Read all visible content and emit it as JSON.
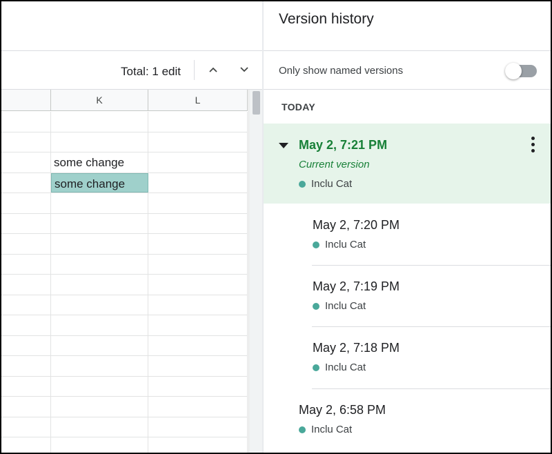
{
  "toolbar": {
    "total": "Total: 1 edit"
  },
  "grid": {
    "columns": [
      "K",
      "L"
    ],
    "cells": [
      {
        "row": 2,
        "text": "some change"
      },
      {
        "row": 3,
        "text": "some change"
      }
    ]
  },
  "panel": {
    "title": "Version history",
    "filter_label": "Only show named versions",
    "toggle_on": false,
    "section": "TODAY",
    "current": {
      "date": "May 2, 7:21 PM",
      "label": "Current version",
      "user": "Inclu Cat"
    },
    "versions": [
      {
        "date": "May 2, 7:20 PM",
        "user": "Inclu Cat"
      },
      {
        "date": "May 2, 7:19 PM",
        "user": "Inclu Cat"
      },
      {
        "date": "May 2, 7:18 PM",
        "user": "Inclu Cat"
      },
      {
        "date": "May 2, 6:58 PM",
        "user": "Inclu Cat"
      }
    ]
  },
  "colors": {
    "accent": "#188038",
    "highlight": "#e6f4ea",
    "user_dot": "#4aa89a",
    "cell_highlight": "#9fd0cb"
  }
}
